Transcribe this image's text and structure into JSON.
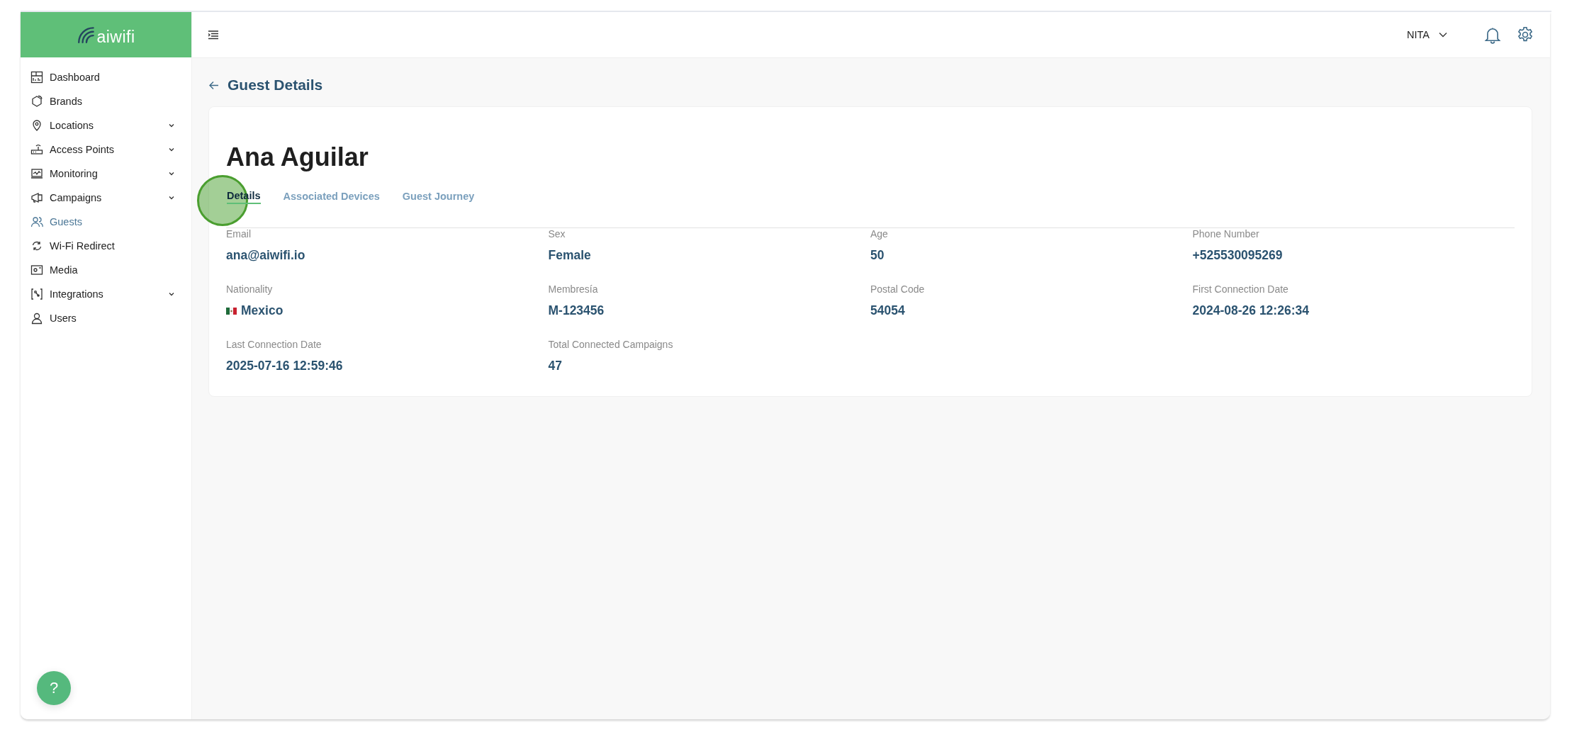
{
  "logo": {
    "text": "aiwifi"
  },
  "sidebar": {
    "items": [
      {
        "label": "Dashboard",
        "kind": "dashboard",
        "expandable": false,
        "selected": false
      },
      {
        "label": "Brands",
        "kind": "brands",
        "expandable": false,
        "selected": false
      },
      {
        "label": "Locations",
        "kind": "pin",
        "expandable": true,
        "selected": false
      },
      {
        "label": "Access Points",
        "kind": "router",
        "expandable": true,
        "selected": false
      },
      {
        "label": "Monitoring",
        "kind": "monitor",
        "expandable": true,
        "selected": false
      },
      {
        "label": "Campaigns",
        "kind": "megaphone",
        "expandable": true,
        "selected": false
      },
      {
        "label": "Guests",
        "kind": "users",
        "expandable": false,
        "selected": true
      },
      {
        "label": "Wi-Fi Redirect",
        "kind": "redirect",
        "expandable": false,
        "selected": false
      },
      {
        "label": "Media",
        "kind": "media",
        "expandable": false,
        "selected": false
      },
      {
        "label": "Integrations",
        "kind": "integrations",
        "expandable": true,
        "selected": false
      },
      {
        "label": "Users",
        "kind": "user",
        "expandable": false,
        "selected": false
      }
    ]
  },
  "header": {
    "user": "NITA"
  },
  "page": {
    "title": "Guest Details"
  },
  "guest": {
    "name": "Ana Aguilar"
  },
  "tabs": [
    {
      "label": "Details",
      "selected": true
    },
    {
      "label": "Associated Devices",
      "selected": false
    },
    {
      "label": "Guest Journey",
      "selected": false
    }
  ],
  "fields": [
    {
      "label": "Email",
      "value": "ana@aiwifi.io"
    },
    {
      "label": "Sex",
      "value": "Female"
    },
    {
      "label": "Age",
      "value": "50"
    },
    {
      "label": "Phone Number",
      "value": "+525530095269"
    },
    {
      "label": "Nationality",
      "value": "Mexico",
      "flag": true
    },
    {
      "label": "Membresía",
      "value": "M-123456"
    },
    {
      "label": "Postal Code",
      "value": "54054"
    },
    {
      "label": "First Connection Date",
      "value": "2024-08-26 12:26:34"
    },
    {
      "label": "Last Connection Date",
      "value": "2025-07-16 12:59:46"
    },
    {
      "label": "Total Connected Campaigns",
      "value": "47"
    }
  ],
  "help": {
    "label": "?"
  }
}
